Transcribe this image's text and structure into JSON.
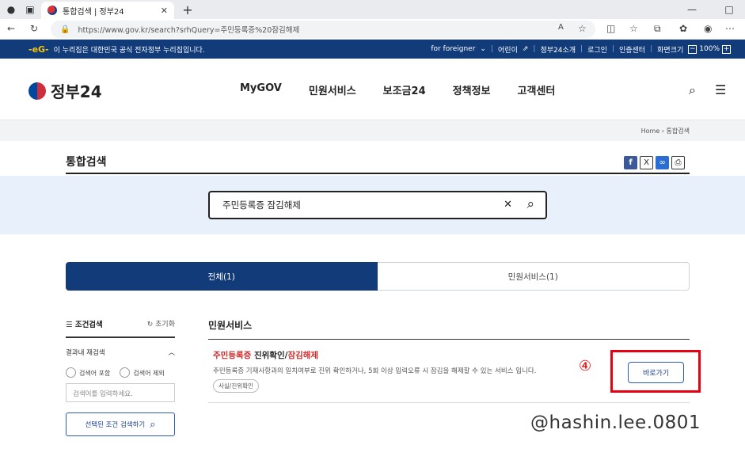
{
  "browser": {
    "tab_title": "통합검색 | 정부24",
    "url": "https://www.gov.kr/search?srhQuery=주민등록증%20잠김해제"
  },
  "govbar": {
    "notice": "이 누리집은 대한민국 공식 전자정부 누리집입니다.",
    "links": [
      "for foreigner",
      "어린이",
      "정부24소개",
      "로그인",
      "인증센터",
      "화면크기"
    ],
    "zoom": "100%"
  },
  "header": {
    "logo": "정부24",
    "nav": [
      "MyGOV",
      "민원서비스",
      "보조금24",
      "정책정보",
      "고객센터"
    ]
  },
  "breadcrumb": {
    "home": "Home",
    "current": "통합검색"
  },
  "page": {
    "title": "통합검색"
  },
  "search": {
    "query": "주민등록증 잠김해제"
  },
  "tabs": [
    "전체(1)",
    "민원서비스(1)"
  ],
  "sidebar": {
    "title": "조건검색",
    "reset": "초기화",
    "section": "결과내 재검색",
    "options": [
      "검색어 포함",
      "검색어 제외"
    ],
    "placeholder": "검색어를 입력하세요.",
    "apply": "선택된 조건 검색하기"
  },
  "results": {
    "section": "민원서비스",
    "item": {
      "title_a": "주민등록증",
      "title_b": " 진위확인/",
      "title_c": "잠김해제",
      "desc": "주민등록증 기재사항과의 일치여부로 진위 확인하거나, 5회 이상 입력오류 시 잠김을 해제할 수 있는 서비스 입니다.",
      "tag": "사실/진위확인",
      "button": "바로가기"
    }
  },
  "annotation": {
    "number": "④",
    "watermark": "@hashin.lee.0801",
    "highlight_color": "#e60012"
  }
}
